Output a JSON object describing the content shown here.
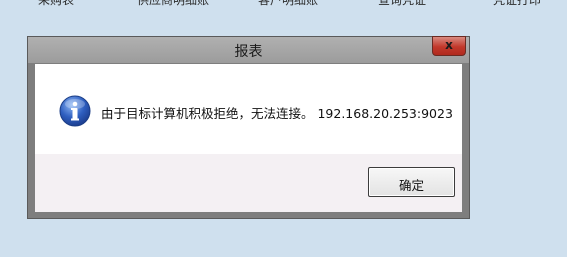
{
  "background_menu": {
    "items": [
      "采购表",
      "供应商明细账",
      "客户明细账",
      "查询凭证",
      "凭证打印"
    ]
  },
  "dialog": {
    "title": "报表",
    "close_label": "x",
    "icon": "information-icon",
    "message": "由于目标计算机积极拒绝，无法连接。 192.168.20.253:9023",
    "ok_label": "确定"
  },
  "colors": {
    "desktop": "#cfe0ee",
    "dialog_frame": "#7e7e7e",
    "close_button": "#c2382b",
    "footer": "#f4f0f3",
    "info_icon": "#2f5fc0"
  }
}
